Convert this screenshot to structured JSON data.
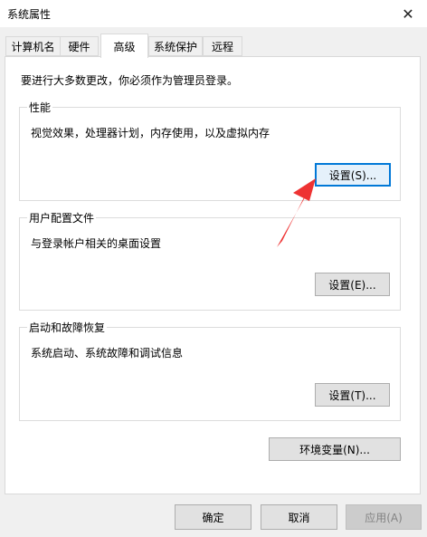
{
  "window": {
    "title": "系统属性",
    "close_glyph": "✕"
  },
  "tabs": [
    {
      "label": "计算机名",
      "active": false
    },
    {
      "label": "硬件",
      "active": false
    },
    {
      "label": "高级",
      "active": true
    },
    {
      "label": "系统保护",
      "active": false
    },
    {
      "label": "远程",
      "active": false
    }
  ],
  "advanced": {
    "intro": "要进行大多数更改，你必须作为管理员登录。",
    "performance": {
      "label": "性能",
      "description": "视觉效果，处理器计划，内存使用，以及虚拟内存",
      "button": "设置(S)..."
    },
    "user_profiles": {
      "label": "用户配置文件",
      "description": "与登录帐户相关的桌面设置",
      "button": "设置(E)..."
    },
    "startup_recovery": {
      "label": "启动和故障恢复",
      "description": "系统启动、系统故障和调试信息",
      "button": "设置(T)..."
    },
    "env_button": "环境变量(N)..."
  },
  "footer": {
    "ok": "确定",
    "cancel": "取消",
    "apply": "应用(A)"
  },
  "colors": {
    "focus_border": "#0078d7",
    "annotation_arrow": "#ee3333"
  }
}
